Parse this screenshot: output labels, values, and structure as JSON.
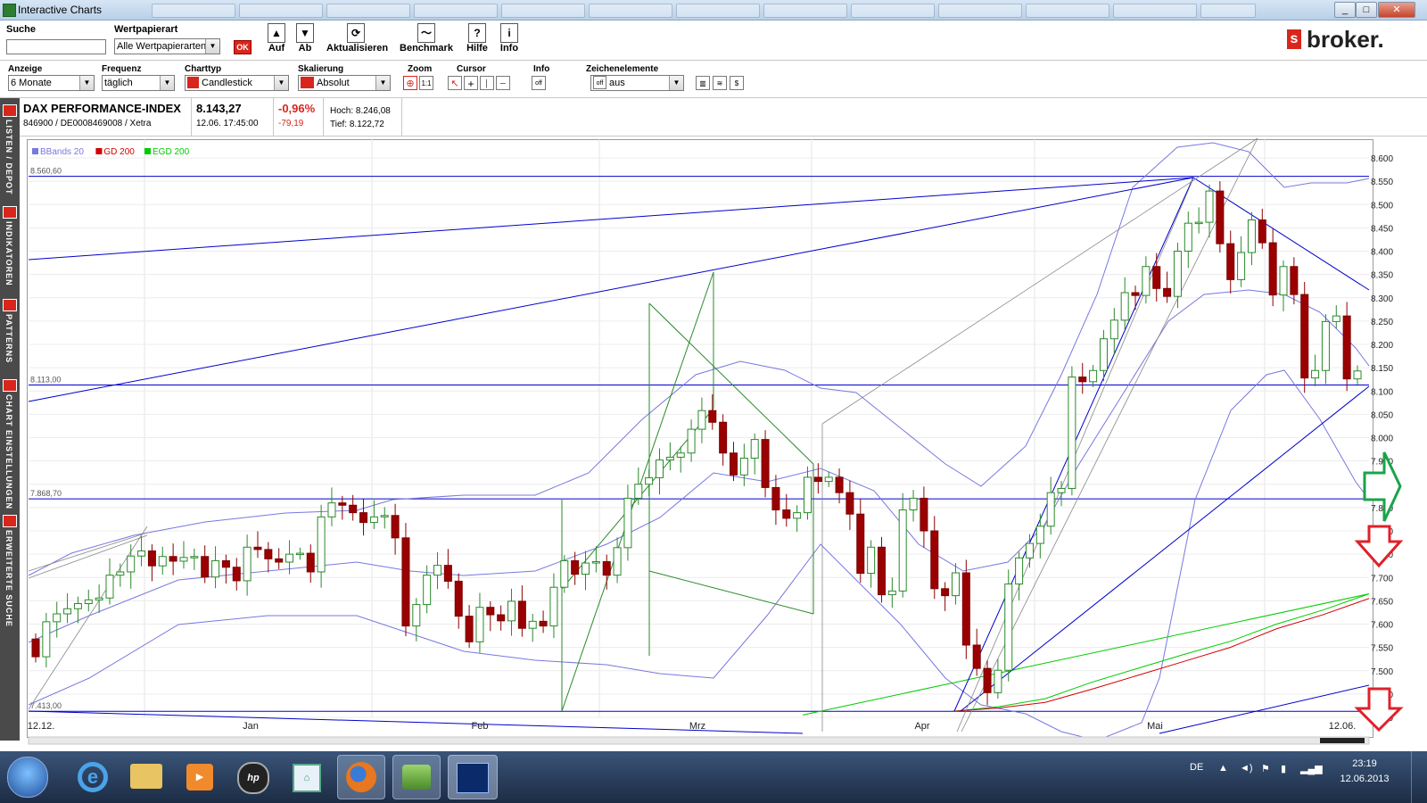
{
  "window": {
    "title": "Interactive Charts",
    "controls": [
      "_",
      "□",
      "✕"
    ]
  },
  "toolbar": {
    "search_label": "Suche",
    "search_value": "",
    "wertpapierart_label": "Wertpapierart",
    "wertpapierart_value": "Alle Wertpapierarten",
    "ok_label": "OK",
    "buttons": [
      {
        "label": "Auf",
        "icon": "▲"
      },
      {
        "label": "Ab",
        "icon": "▼"
      },
      {
        "label": "Aktualisieren",
        "icon": "⟳"
      },
      {
        "label": "Benchmark",
        "icon": "〜"
      },
      {
        "label": "Hilfe",
        "icon": "?"
      },
      {
        "label": "Info",
        "icon": "i"
      }
    ],
    "brand": "broker."
  },
  "settings": {
    "anzeige_label": "Anzeige",
    "anzeige_value": "6 Monate",
    "frequenz_label": "Frequenz",
    "frequenz_value": "täglich",
    "charttyp_label": "Charttyp",
    "charttyp_value": "Candlestick",
    "skalierung_label": "Skalierung",
    "skalierung_value": "Absolut",
    "zoom_label": "Zoom",
    "zoom_ratio": "1:1",
    "cursor_label": "Cursor",
    "info_label": "Info",
    "info_value": "off",
    "zeichen_label": "Zeichenelemente",
    "zeichen_value": "aus",
    "zeichen_off": "off"
  },
  "sidebar": {
    "items": [
      "LISTEN / DEPOT",
      "INDIKATOREN",
      "PATTERNS",
      "CHART EINSTELLUNGEN",
      "ERWEITERTE SUCHE"
    ]
  },
  "instrument": {
    "name": "DAX PERFORMANCE-INDEX",
    "ids": "846900 / DE0008469008 / Xetra",
    "price": "8.143,27",
    "datetime": "12.06. 17:45:00",
    "change_pct": "-0,96%",
    "change_abs": "-79,19",
    "high": "Hoch: 8.246,08",
    "low": "Tief: 8.122,72"
  },
  "legend": [
    {
      "label": "BBands 20",
      "color": "#7878e0"
    },
    {
      "label": "GD 200",
      "color": "#d40000"
    },
    {
      "label": "EGD 200",
      "color": "#00cc00"
    }
  ],
  "hlines": [
    {
      "label": "8.560,60",
      "value": 8560.6
    },
    {
      "label": "8.113,00",
      "value": 8113.0
    },
    {
      "label": "7.868,70",
      "value": 7868.7
    },
    {
      "label": "7.413,00",
      "value": 7413.0
    }
  ],
  "yticks": [
    "8.600",
    "8.550",
    "8.500",
    "8.450",
    "8.400",
    "8.350",
    "8.300",
    "8.250",
    "8.200",
    "8.150",
    "8.100",
    "8.050",
    "8.000",
    "7.950",
    "7.900",
    "7.850",
    "7.800",
    "7.750",
    "7.700",
    "7.650",
    "7.600",
    "7.550",
    "7.500",
    "7.450",
    "7.400"
  ],
  "xlabels": [
    "12.12.",
    "Jan",
    "Feb",
    "Mrz",
    "Apr",
    "Mai",
    "12.06."
  ],
  "chart_data": {
    "type": "candlestick",
    "title": "DAX PERFORMANCE-INDEX",
    "ylim": [
      7400,
      8640
    ],
    "x_labels": [
      "12.12.",
      "Jan",
      "Feb",
      "Mrz",
      "Apr",
      "Mai",
      "12.06."
    ],
    "series": [
      {
        "name": "DAX",
        "closes": [
          7530,
          7605,
          7622,
          7633,
          7644,
          7652,
          7656,
          7705,
          7712,
          7746,
          7757,
          7725,
          7745,
          7735,
          7743,
          7745,
          7701,
          7736,
          7722,
          7693,
          7765,
          7760,
          7740,
          7733,
          7750,
          7752,
          7712,
          7830,
          7860,
          7855,
          7839,
          7818,
          7830,
          7833,
          7785,
          7596,
          7642,
          7705,
          7726,
          7692,
          7617,
          7562,
          7636,
          7620,
          7607,
          7649,
          7591,
          7606,
          7596,
          7679,
          7736,
          7707,
          7731,
          7734,
          7705,
          7764,
          7870,
          7900,
          7914,
          7952,
          7958,
          7967,
          8018,
          8058,
          8033,
          7967,
          7920,
          7956,
          7996,
          7893,
          7845,
          7827,
          7839,
          7915,
          7906,
          7915,
          7882,
          7836,
          7709,
          7765,
          7663,
          7671,
          7845,
          7870,
          7800,
          7676,
          7661,
          7710,
          7555,
          7505,
          7453,
          7501,
          7686,
          7742,
          7773,
          7810,
          7882,
          7891,
          8130,
          8120,
          8144,
          8212,
          8252,
          8311,
          8305,
          8367,
          8320,
          8303,
          8400,
          8460,
          8462,
          8529,
          8416,
          8339,
          8397,
          8467,
          8418,
          8306,
          8367,
          8307,
          8128,
          8144,
          8249,
          8261,
          8126,
          8143
        ]
      },
      {
        "name": "GD 200",
        "values": [
          7413,
          7420,
          7432,
          7460,
          7490,
          7520,
          7550,
          7590,
          7620,
          7655
        ]
      },
      {
        "name": "EGD 200",
        "values": [
          7413,
          7423,
          7440,
          7475,
          7505,
          7535,
          7563,
          7600,
          7630,
          7665
        ]
      }
    ]
  },
  "taskbar": {
    "lang": "DE",
    "time": "23:19",
    "date": "12.06.2013",
    "items": [
      "windows-start",
      "internet-explorer",
      "file-explorer",
      "media-player",
      "hp",
      "desktop-app",
      "firefox",
      "app-green",
      "interactive-charts"
    ]
  }
}
